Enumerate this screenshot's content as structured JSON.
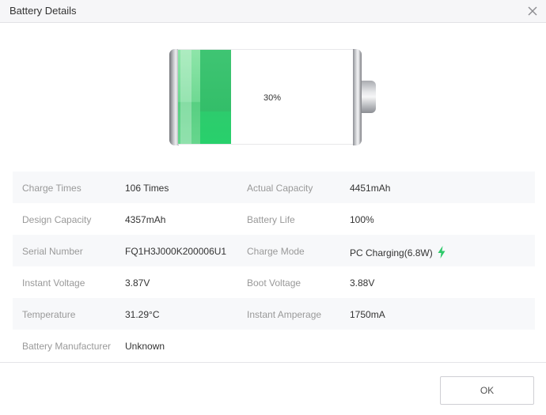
{
  "window": {
    "title": "Battery Details",
    "close_icon": "close-icon"
  },
  "battery": {
    "level_percent": 30,
    "label": "30%",
    "fill_color": "#2dcc6d"
  },
  "details": {
    "rows": [
      {
        "label1": "Charge Times",
        "value1": "106 Times",
        "label2": "Actual Capacity",
        "value2": "4451mAh"
      },
      {
        "label1": "Design Capacity",
        "value1": "4357mAh",
        "label2": "Battery Life",
        "value2": "100%"
      },
      {
        "label1": "Serial Number",
        "value1": "FQ1H3J000K200006U1",
        "label2": "Charge Mode",
        "value2": "PC Charging(6.8W)"
      },
      {
        "label1": "Instant Voltage",
        "value1": "3.87V",
        "label2": "Boot Voltage",
        "value2": "3.88V"
      },
      {
        "label1": "Temperature",
        "value1": "31.29°C",
        "label2": "Instant Amperage",
        "value2": "1750mA"
      },
      {
        "label1": "Battery Manufacturer",
        "value1": "Unknown",
        "label2": "",
        "value2": ""
      }
    ],
    "charging_icon": "lightning-bolt-icon",
    "charging_icon_color": "#2ec96a"
  },
  "footer": {
    "ok_label": "OK"
  }
}
